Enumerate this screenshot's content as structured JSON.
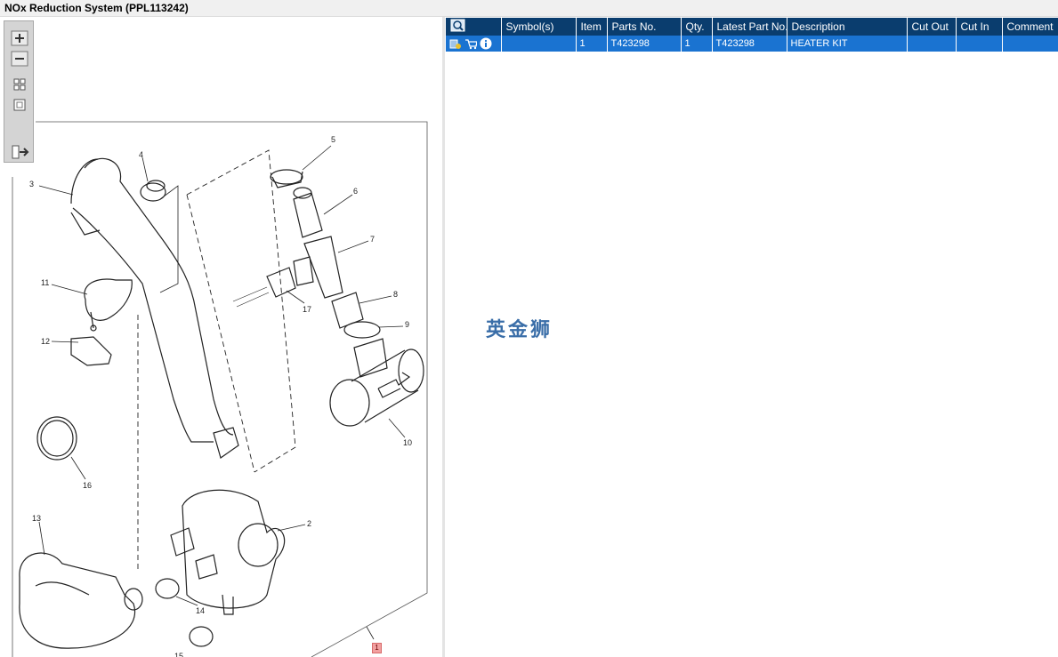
{
  "window": {
    "title": "NOx Reduction System (PPL113242)"
  },
  "toolbar": {
    "items": [
      {
        "name": "zoom-in-icon"
      },
      {
        "name": "zoom-out-icon"
      },
      {
        "name": "fit-grid-icon"
      },
      {
        "name": "actual-size-icon"
      },
      {
        "name": "panel-toggle-icon"
      }
    ]
  },
  "diagram": {
    "callouts": [
      "1",
      "2",
      "3",
      "4",
      "5",
      "6",
      "7",
      "8",
      "9",
      "10",
      "11",
      "12",
      "13",
      "14",
      "15",
      "16",
      "17"
    ],
    "marker": "1"
  },
  "grid": {
    "columns": [
      "Symbol(s)",
      "Item",
      "Parts No.",
      "Qty.",
      "Latest Part No.",
      "Description",
      "Cut Out",
      "Cut In",
      "Comment"
    ],
    "rows": [
      {
        "symbols": "",
        "item": "1",
        "parts_no": "T423298",
        "qty": "1",
        "latest_part_no": "T423298",
        "description": "HEATER KIT",
        "cut_out": "",
        "cut_in": "",
        "comment": ""
      }
    ]
  },
  "watermark": "英金狮",
  "colors": {
    "header": "#0a3d6e",
    "selected_row": "#1a73d1",
    "watermark": "#3a6ea8"
  }
}
